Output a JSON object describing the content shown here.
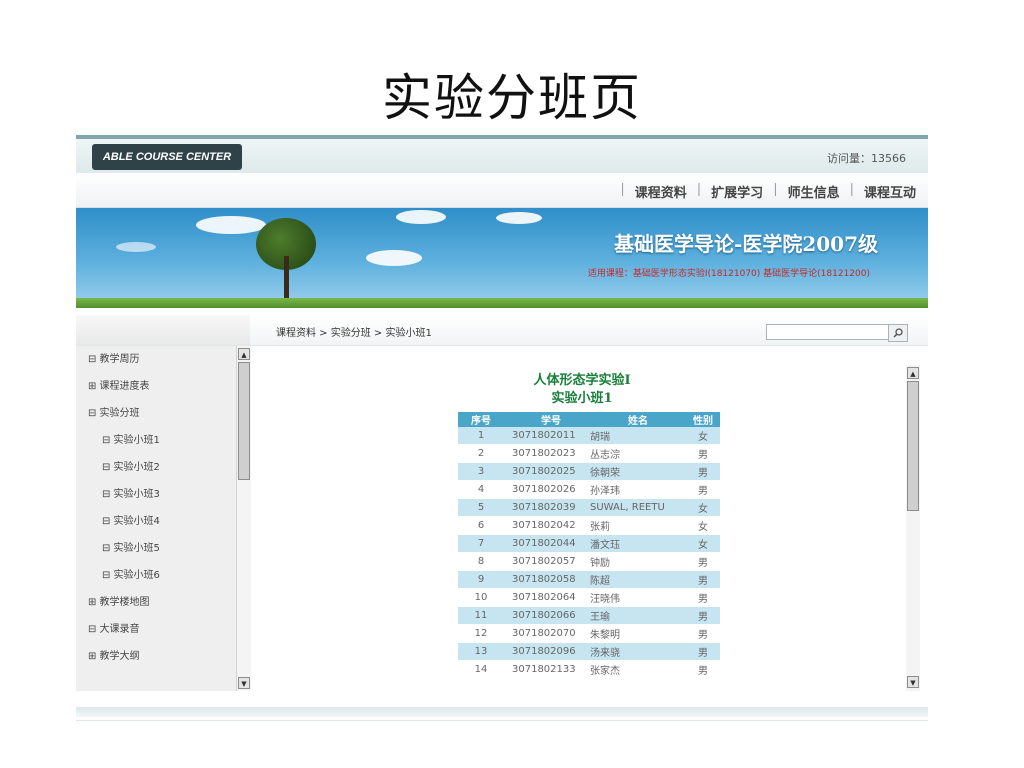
{
  "slide": {
    "title": "实验分班页"
  },
  "header": {
    "logo": "ABLE COURSE CENTER",
    "visits": "访问量：13566"
  },
  "nav": {
    "items": [
      "课程资料",
      "扩展学习",
      "师生信息",
      "课程互动"
    ],
    "separator": "|"
  },
  "banner": {
    "title": "基础医学导论-医学院2007级",
    "subtitle": "适用课程：基础医学形态实验Ⅰ(18121070) 基础医学导论(18121200)"
  },
  "breadcrumb": {
    "text": "课程资料 > 实验分班  > 实验小班1",
    "search_value": "",
    "search_icon": "magnifier-icon"
  },
  "sidebar": {
    "items": [
      {
        "label": "⊟ 教学周历"
      },
      {
        "label": "⊞ 课程进度表"
      },
      {
        "label": "⊟ 实验分班"
      },
      {
        "label": "⊟ 实验小班1"
      },
      {
        "label": "⊟ 实验小班2"
      },
      {
        "label": "⊟ 实验小班3"
      },
      {
        "label": "⊟ 实验小班4"
      },
      {
        "label": "⊟ 实验小班5"
      },
      {
        "label": "⊟ 实验小班6"
      },
      {
        "label": "⊞ 教学楼地图"
      },
      {
        "label": "⊟ 大课录音"
      },
      {
        "label": "⊞ 教学大纲"
      }
    ]
  },
  "table": {
    "title_line1": "人体形态学实验I",
    "title_line2": "实验小班1",
    "headers": [
      "序号",
      "学号",
      "姓名",
      "性别"
    ],
    "rows": [
      [
        "1",
        "3071802011",
        "胡瑞",
        "女"
      ],
      [
        "2",
        "3071802023",
        "丛志淙",
        "男"
      ],
      [
        "3",
        "3071802025",
        "徐朝荣",
        "男"
      ],
      [
        "4",
        "3071802026",
        "孙泽玮",
        "男"
      ],
      [
        "5",
        "3071802039",
        "SUWAL, REETU",
        "女"
      ],
      [
        "6",
        "3071802042",
        "张莉",
        "女"
      ],
      [
        "7",
        "3071802044",
        "潘文珏",
        "女"
      ],
      [
        "8",
        "3071802057",
        "钟励",
        "男"
      ],
      [
        "9",
        "3071802058",
        "陈超",
        "男"
      ],
      [
        "10",
        "3071802064",
        "汪晓伟",
        "男"
      ],
      [
        "11",
        "3071802066",
        "王瑜",
        "男"
      ],
      [
        "12",
        "3071802070",
        "朱黎明",
        "男"
      ],
      [
        "13",
        "3071802096",
        "汤来骁",
        "男"
      ],
      [
        "14",
        "3071802133",
        "张家杰",
        "男"
      ]
    ]
  }
}
